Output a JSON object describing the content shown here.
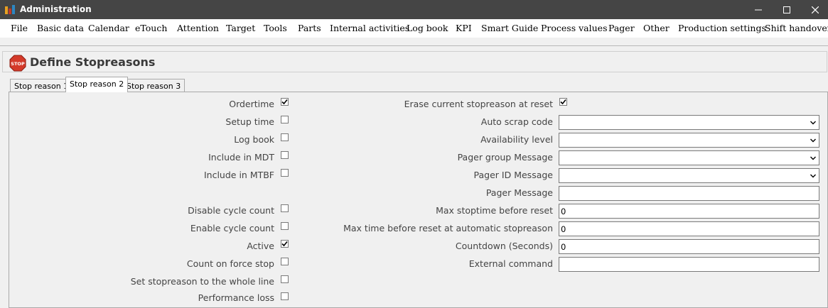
{
  "window": {
    "title": "Administration"
  },
  "menu": [
    "File",
    "Basic data",
    "Calendar",
    "eTouch",
    "Attention",
    "Target",
    "Tools",
    "Parts",
    "Internal activities",
    "Log book",
    "KPI",
    "Smart Guide",
    "Process values",
    "Pager",
    "Other",
    "Production settings",
    "Shift handover"
  ],
  "page": {
    "title": "Define Stopreasons",
    "icon": "stop-sign-icon",
    "icon_text": "STOP"
  },
  "tabs": [
    "Stop reason 1",
    "Stop reason 2",
    "Stop reason 3"
  ],
  "active_tab": "Stop reason 2",
  "left_fields": [
    {
      "label": "Ordertime",
      "checked": true
    },
    {
      "label": "Setup time",
      "checked": false
    },
    {
      "label": "Log book",
      "checked": false
    },
    {
      "label": "Include in MDT",
      "checked": false
    },
    {
      "label": "Include in MTBF",
      "checked": false
    },
    {
      "label": "Disable cycle count",
      "checked": false
    },
    {
      "label": "Enable cycle count",
      "checked": false
    },
    {
      "label": "Active",
      "checked": true
    },
    {
      "label": "Count on force stop",
      "checked": false
    },
    {
      "label": "Set stopreason to the whole line",
      "checked": false
    },
    {
      "label": "Performance loss",
      "checked": false
    }
  ],
  "right_fields": {
    "erase_label": "Erase current stopreason at reset",
    "erase_checked": true,
    "auto_scrap": {
      "label": "Auto scrap code",
      "value": ""
    },
    "availability": {
      "label": "Availability level",
      "value": ""
    },
    "pager_group": {
      "label": "Pager group Message",
      "value": ""
    },
    "pager_id": {
      "label": "Pager ID Message",
      "value": ""
    },
    "pager_message": {
      "label": "Pager Message",
      "value": ""
    },
    "max_stoptime": {
      "label": "Max stoptime before reset",
      "value": "0"
    },
    "max_time_auto": {
      "label": "Max time before reset at automatic stopreason",
      "value": "0"
    },
    "countdown": {
      "label": "Countdown (Seconds)",
      "value": "0"
    },
    "external_command": {
      "label": "External command",
      "value": ""
    }
  },
  "colors": {
    "titlebar": "#454545",
    "stop_red": "#d43a2a"
  }
}
